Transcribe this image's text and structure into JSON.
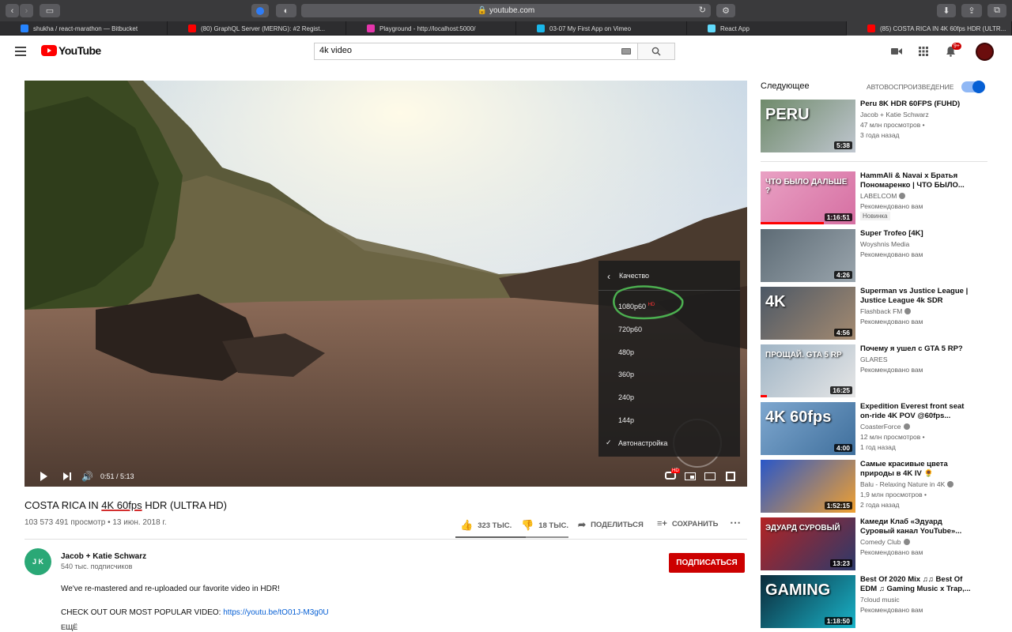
{
  "browser": {
    "url": "youtube.com",
    "tabs": [
      {
        "label": "shukha / react-marathon — Bitbucket",
        "color": "#2684ff"
      },
      {
        "label": "(80) GraphQL Server (MERNG): #2 Regist...",
        "color": "#ff0000"
      },
      {
        "label": "Playground - http://localhost:5000/",
        "color": "#e535ab"
      },
      {
        "label": "03-07 My First App on Vimeo",
        "color": "#1ab7ea"
      },
      {
        "label": "React App",
        "color": "#61dafb"
      },
      {
        "label": "(85) COSTA RICA IN 4K 60fps HDR (ULTR...",
        "color": "#ff0000"
      }
    ]
  },
  "header": {
    "logo_text": "YouTube",
    "search_value": "4k video",
    "notification_count": "9+"
  },
  "player": {
    "time": "0:51 / 5:13",
    "progress_fraction": 0.163,
    "buffered_fraction": 0.26,
    "quality_menu": {
      "title": "Качество",
      "options": [
        "1080p60",
        "720p60",
        "480p",
        "360p",
        "240p",
        "144p",
        "Автонастройка"
      ],
      "hd_badge": "HD"
    }
  },
  "video": {
    "title_prefix": "COSTA RICA IN ",
    "title_underlined": "4K 60fps",
    "title_suffix": " HDR (ULTRA HD)",
    "meta": "103 573 491 просмотр • 13 июн. 2018 г.",
    "likes": "323 ТЫС.",
    "dislikes": "18 ТЫС.",
    "share": "ПОДЕЛИТЬСЯ",
    "save": "СОХРАНИТЬ",
    "like_fraction": 0.62
  },
  "channel": {
    "name": "Jacob + Katie Schwarz",
    "subs": "540 тыс. подписчиков",
    "subscribe": "ПОДПИСАТЬСЯ",
    "avatar_text": "J K"
  },
  "description": {
    "line1": "We've re-mastered and re-uploaded our favorite video in HDR!",
    "line2_prefix": "CHECK OUT OUR MOST POPULAR VIDEO: ",
    "line2_link": "https://youtu.be/tO01J-M3g0U",
    "more": "ЕЩЁ"
  },
  "sidebar": {
    "next_label": "Следующее",
    "autoplay_label": "АВТОВОСПРОИЗВЕДЕНИЕ",
    "items": [
      {
        "title1": "Peru 8K HDR 60FPS (FUHD)",
        "title2": "",
        "channel": "Jacob + Katie Schwarz",
        "line1": "47 млн просмотров •",
        "line2": "3 года назад",
        "duration": "5:38",
        "thumb_text": "PERU",
        "verified": false
      },
      {
        "title1": "HammAli & Navai x Братья",
        "title2": "Пономаренко | ЧТО БЫЛО...",
        "channel": "LABELCOM",
        "line1": "Рекомендовано вам",
        "line2": "",
        "duration": "1:16:51",
        "badge": "Новинка",
        "thumb_text": "ЧТО БЫЛО ДАЛЬШЕ ?",
        "verified": true
      },
      {
        "title1": "Super Trofeo [4K]",
        "title2": "",
        "channel": "Woyshnis Media",
        "line1": "Рекомендовано вам",
        "line2": "",
        "duration": "4:26",
        "thumb_text": "",
        "verified": false
      },
      {
        "title1": "Superman vs Justice League |",
        "title2": "Justice League 4k SDR",
        "channel": "Flashback FM",
        "line1": "Рекомендовано вам",
        "line2": "",
        "duration": "4:56",
        "thumb_text": "4K",
        "verified": true
      },
      {
        "title1": "Почему я ушел с GTA 5 RP?",
        "title2": "",
        "channel": "GLARES",
        "line1": "Рекомендовано вам",
        "line2": "",
        "duration": "16:25",
        "thumb_text": "ПРОЩАЙ. GTA 5 RP",
        "verified": false
      },
      {
        "title1": "Expedition Everest front seat",
        "title2": "on-ride 4K POV @60fps...",
        "channel": "CoasterForce",
        "line1": "12 млн просмотров •",
        "line2": "1 год назад",
        "duration": "4:00",
        "thumb_text": "4K 60fps",
        "verified": true
      },
      {
        "title1": "Самые красивые цвета",
        "title2": "природы в 4K IV 🌻",
        "channel": "Balu - Relaxing Nature in 4K",
        "line1": "1,9 млн просмотров •",
        "line2": "2 года назад",
        "duration": "1:52:15",
        "thumb_text": "",
        "verified": true
      },
      {
        "title1": "Камеди Клаб «Эдуард",
        "title2": "Суровый канал YouTube»...",
        "channel": "Comedy Club",
        "line1": "Рекомендовано вам",
        "line2": "",
        "duration": "13:23",
        "thumb_text": "ЭДУАРД СУРОВЫЙ",
        "verified": true
      },
      {
        "title1": "Best Of 2020 Mix ♫♫ Best Of",
        "title2": "EDM ♫ Gaming Music x Trap,...",
        "channel": "7cloud music",
        "line1": "Рекомендовано вам",
        "line2": "",
        "duration": "1:18:50",
        "thumb_text": "GAMING",
        "verified": false
      }
    ]
  }
}
